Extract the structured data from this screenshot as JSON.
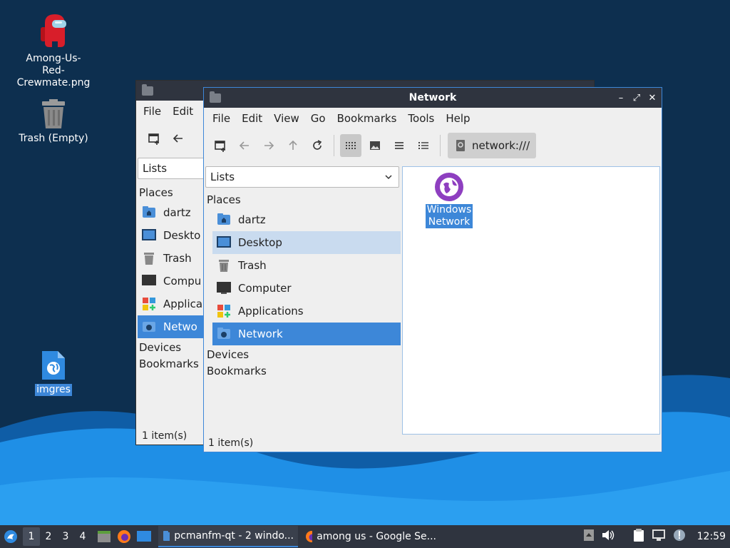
{
  "desktop": {
    "icons": [
      {
        "label_line1": "Among-Us-Red-",
        "label_line2": "Crewmate.png"
      },
      {
        "label": "Trash (Empty)"
      },
      {
        "label": "imgres"
      }
    ]
  },
  "back_window": {
    "menu": [
      "File",
      "Edit"
    ],
    "lists_label": "Lists",
    "places_header": "Places",
    "places": [
      "dartz",
      "Deskto",
      "Trash",
      "Compu",
      "Applica",
      "Netwo"
    ],
    "devices_header": "Devices",
    "bookmarks_header": "Bookmarks",
    "status": "1 item(s)"
  },
  "front_window": {
    "title": "Network",
    "controls": {
      "minimize": "–",
      "maximize": "⤢",
      "close": "✕"
    },
    "menu": [
      "File",
      "Edit",
      "View",
      "Go",
      "Bookmarks",
      "Tools",
      "Help"
    ],
    "address": "network:///",
    "lists_label": "Lists",
    "places_header": "Places",
    "places": [
      "dartz",
      "Desktop",
      "Trash",
      "Computer",
      "Applications",
      "Network"
    ],
    "selected_place": "Network",
    "devices_header": "Devices",
    "bookmarks_header": "Bookmarks",
    "content_items": [
      {
        "label_line1": "Windows",
        "label_line2": "Network"
      }
    ],
    "status": "1 item(s)"
  },
  "taskbar": {
    "workspaces": [
      "1",
      "2",
      "3",
      "4"
    ],
    "active_workspace": "1",
    "tasks": [
      {
        "label": "pcmanfm-qt - 2 windo...",
        "icon": "folder-icon"
      },
      {
        "label": "among us - Google Se...",
        "icon": "firefox-icon"
      }
    ],
    "clock": "12:59"
  },
  "colors": {
    "accent": "#3d87d8",
    "titlebar": "#2f343f",
    "desktop_dark": "#0d2f4f",
    "wave_blue": "#1f8fe6",
    "network_purple": "#8e3fc0"
  }
}
